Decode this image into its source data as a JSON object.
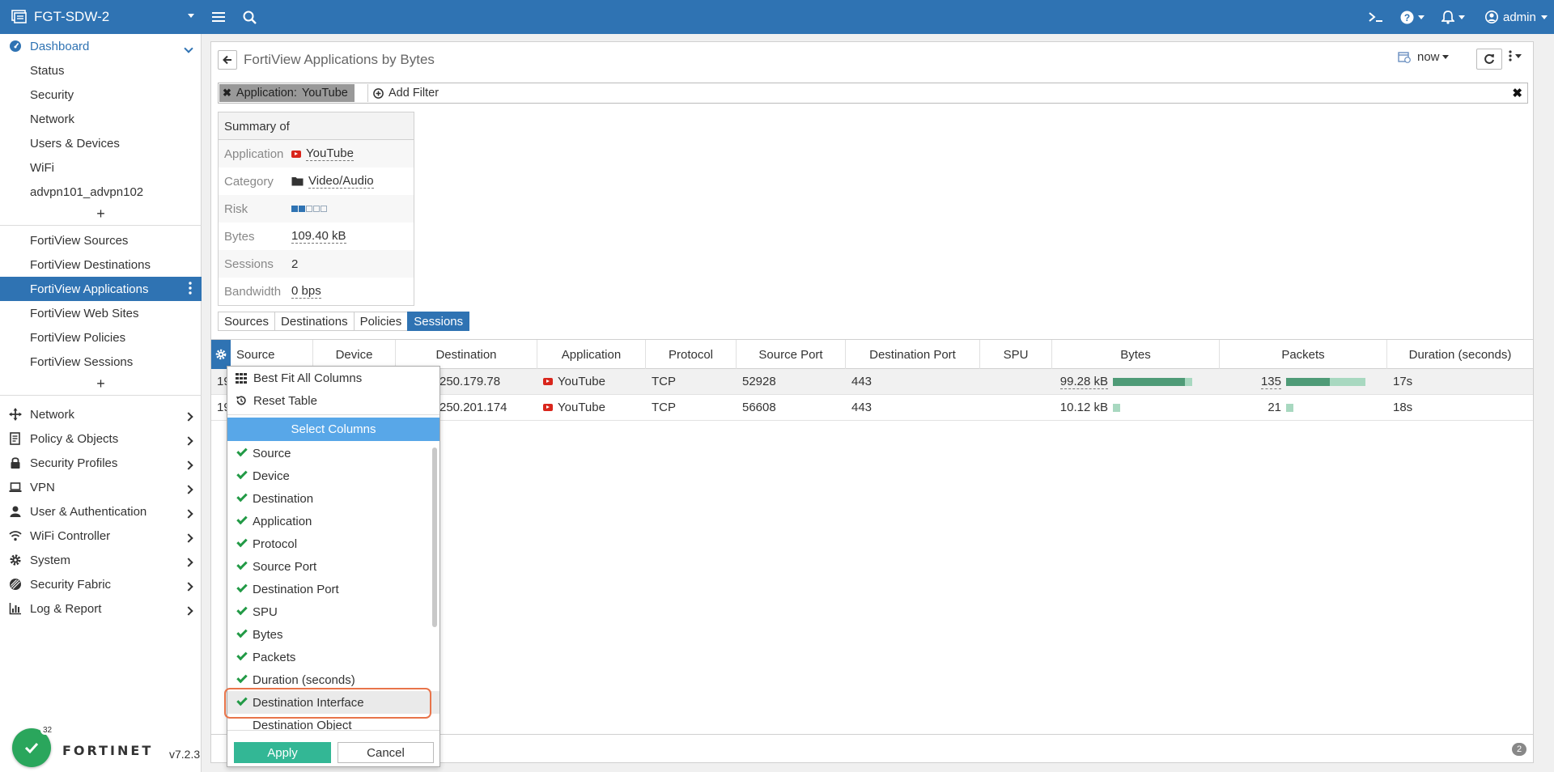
{
  "topbar": {
    "device_name": "FGT-SDW-2",
    "user": "admin",
    "icons": [
      "menu-icon",
      "search-icon",
      "cli-icon",
      "help-icon",
      "bell-icon",
      "user-icon"
    ]
  },
  "sidebar": {
    "dashboard": {
      "label": "Dashboard",
      "items": [
        "Status",
        "Security",
        "Network",
        "Users & Devices",
        "WiFi",
        "advpn101_advpn102"
      ],
      "fortiview": [
        "FortiView Sources",
        "FortiView Destinations",
        "FortiView Applications",
        "FortiView Web Sites",
        "FortiView Policies",
        "FortiView Sessions"
      ],
      "active": "FortiView Applications"
    },
    "plus": "+",
    "sections": [
      "Network",
      "Policy & Objects",
      "Security Profiles",
      "VPN",
      "User & Authentication",
      "WiFi Controller",
      "System",
      "Security Fabric",
      "Log & Report"
    ],
    "status_count": "32",
    "logo": "FORTINET",
    "version": "v7.2.3"
  },
  "main": {
    "title": "FortiView Applications by Bytes",
    "time": "now",
    "filter": {
      "chip_key": "Application:",
      "chip_value": "YouTube",
      "add_filter": "Add Filter"
    },
    "summary": {
      "header": "Summary of",
      "rows": [
        {
          "label": "Application",
          "value": "YouTube"
        },
        {
          "label": "Category",
          "value": "Video/Audio"
        },
        {
          "label": "Risk",
          "value": ""
        },
        {
          "label": "Bytes",
          "value": "109.40 kB"
        },
        {
          "label": "Sessions",
          "value": "2"
        },
        {
          "label": "Bandwidth",
          "value": "0 bps"
        }
      ],
      "risk_level": 2,
      "risk_max": 5
    },
    "tabs": [
      "Sources",
      "Destinations",
      "Policies",
      "Sessions"
    ],
    "active_tab": "Sessions",
    "columns": [
      "Source",
      "Device",
      "Destination",
      "Application",
      "Protocol",
      "Source Port",
      "Destination Port",
      "SPU",
      "Bytes",
      "Packets",
      "Duration (seconds)"
    ],
    "rows": [
      {
        "source": "19",
        "destination": "250.179.78",
        "application": "YouTube",
        "protocol": "TCP",
        "source_port": "52928",
        "destination_port": "443",
        "spu": "",
        "bytes": "99.28 kB",
        "bytes_fraction": 0.91,
        "packets": "135",
        "packets_fraction": 0.55,
        "duration": "17s"
      },
      {
        "source": "19",
        "destination": "250.201.174",
        "application": "YouTube",
        "protocol": "TCP",
        "source_port": "56608",
        "destination_port": "443",
        "spu": "",
        "bytes": "10.12 kB",
        "bytes_fraction": 0.09,
        "packets": "21",
        "packets_fraction": 0.09,
        "duration": "18s"
      }
    ],
    "page_count": "2"
  },
  "column_menu": {
    "best_fit": "Best Fit All Columns",
    "reset": "Reset Table",
    "title": "Select Columns",
    "items": [
      {
        "label": "Source",
        "checked": true
      },
      {
        "label": "Device",
        "checked": true
      },
      {
        "label": "Destination",
        "checked": true
      },
      {
        "label": "Application",
        "checked": true
      },
      {
        "label": "Protocol",
        "checked": true
      },
      {
        "label": "Source Port",
        "checked": true
      },
      {
        "label": "Destination Port",
        "checked": true
      },
      {
        "label": "SPU",
        "checked": true
      },
      {
        "label": "Bytes",
        "checked": true
      },
      {
        "label": "Packets",
        "checked": true
      },
      {
        "label": "Duration (seconds)",
        "checked": true
      },
      {
        "label": "Destination Interface",
        "checked": true
      },
      {
        "label": "Destination Object",
        "checked": false
      }
    ],
    "apply": "Apply",
    "cancel": "Cancel"
  },
  "colors": {
    "brand_blue": "#2f73b3",
    "select_columns_blue": "#58a7e8",
    "apply_green": "#33b795",
    "check_green": "#229a46",
    "highlight_orange": "#e8744a"
  }
}
